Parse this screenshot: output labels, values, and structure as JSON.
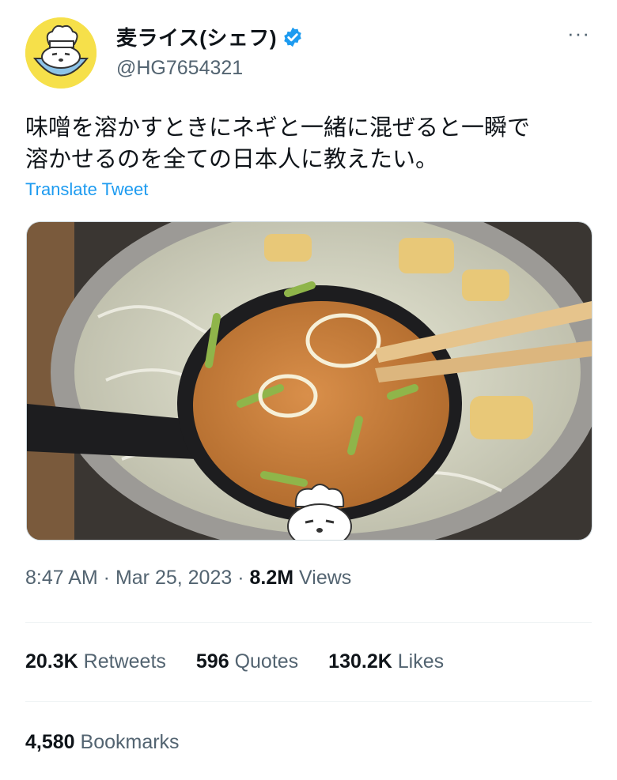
{
  "author": {
    "display_name": "麦ライス(シェフ)",
    "handle": "@HG7654321",
    "avatar_icon": "chef-rice-bowl-mascot",
    "verified_icon": "verified-badge-icon",
    "verified_color": "#1d9bf0"
  },
  "more_menu": {
    "label": "···",
    "icon": "more-horizontal-icon"
  },
  "tweet": {
    "text": "味噌を溶かすときにネギと一緒に混ぜると一瞬で\n溶かせるのを全ての日本人に教えたい。",
    "translate_label": "Translate Tweet",
    "media_description_icon": "ladle-miso-photo"
  },
  "meta": {
    "time": "8:47 AM",
    "separator": " · ",
    "date": "Mar 25, 2023",
    "views_count": "8.2M",
    "views_label": "Views"
  },
  "stats": {
    "retweets_count": "20.3K",
    "retweets_label": "Retweets",
    "quotes_count": "596",
    "quotes_label": "Quotes",
    "likes_count": "130.2K",
    "likes_label": "Likes"
  },
  "bookmarks": {
    "count": "4,580",
    "label": "Bookmarks"
  },
  "colors": {
    "link": "#1d9bf0",
    "secondary_text": "#536471",
    "primary_text": "#0f1419",
    "divider": "#eff3f4",
    "avatar_bg": "#f6e04a"
  }
}
